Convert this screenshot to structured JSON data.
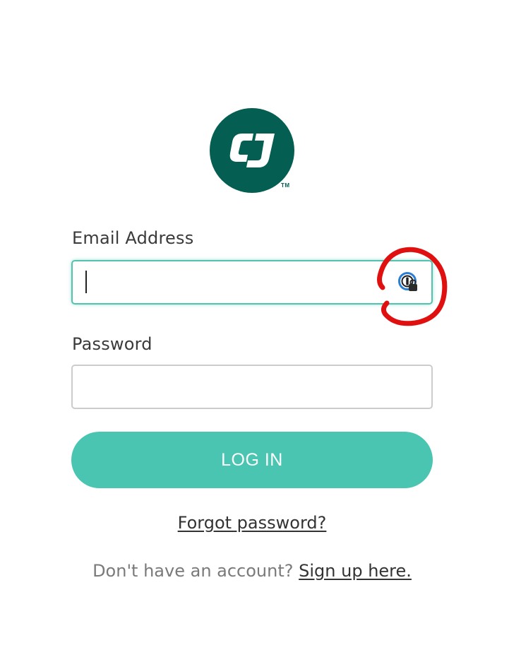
{
  "logo": {
    "mark_text": "CJ",
    "trademark": "TM",
    "colors": {
      "circle": "#055e52",
      "mark": "#ffffff"
    }
  },
  "form": {
    "email": {
      "label": "Email Address",
      "value": "",
      "placeholder": "",
      "focused": true,
      "password_manager_icon": "password-manager-lock-icon"
    },
    "password": {
      "label": "Password",
      "value": "",
      "placeholder": ""
    },
    "login_button": "LOG IN",
    "forgot_password": "Forgot password?",
    "signup_prompt": "Don't have an account?",
    "signup_link": "Sign up here."
  },
  "colors": {
    "accent": "#49c5b1",
    "focus_border": "#55c2b0",
    "annotation": "#e01010",
    "text": "#333333",
    "muted_text": "#7a7a7a"
  }
}
